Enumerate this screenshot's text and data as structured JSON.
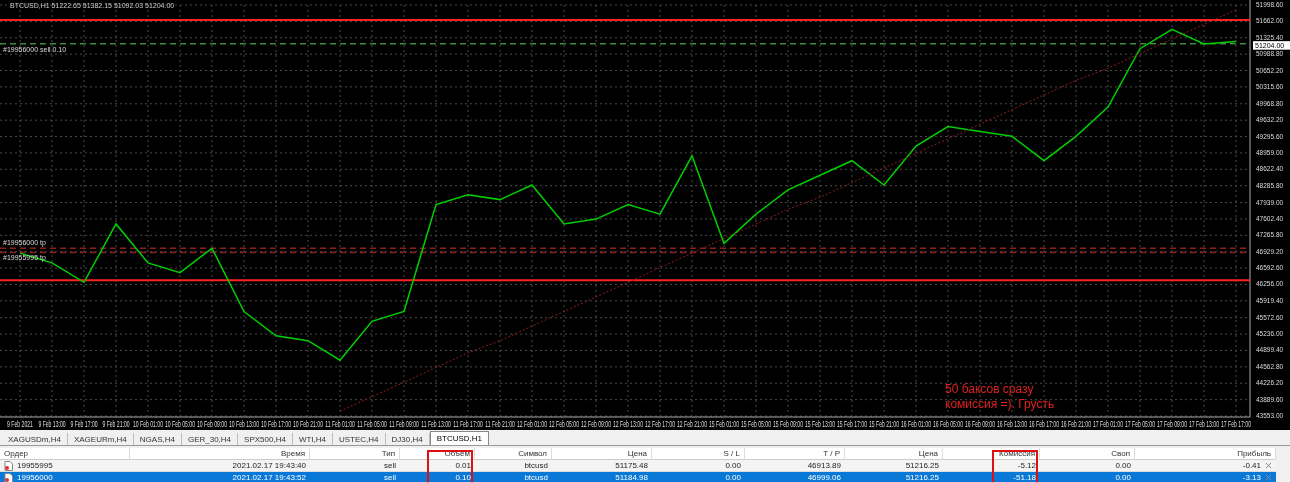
{
  "chart": {
    "current_price": "51204.00",
    "note": [
      "50 баксов сразу",
      "комиссия =). Грусть"
    ],
    "chart_data": {
      "type": "line",
      "title": "BTCUSD,H1  51222.65 51382.15 51092.03 51204.00",
      "grid": true,
      "categories": [
        "9 Feb 2021",
        "9 Feb 13:00",
        "9 Feb 17:00",
        "9 Feb 21:00",
        "10 Feb 01:00",
        "10 Feb 05:00",
        "10 Feb 09:00",
        "10 Feb 13:00",
        "10 Feb 17:00",
        "10 Feb 21:00",
        "11 Feb 01:00",
        "11 Feb 05:00",
        "11 Feb 09:00",
        "11 Feb 13:00",
        "11 Feb 17:00",
        "11 Feb 21:00",
        "12 Feb 01:00",
        "12 Feb 05:00",
        "12 Feb 09:00",
        "12 Feb 13:00",
        "12 Feb 17:00",
        "12 Feb 21:00",
        "15 Feb 01:00",
        "15 Feb 05:00",
        "15 Feb 09:00",
        "15 Feb 13:00",
        "15 Feb 17:00",
        "15 Feb 21:00",
        "16 Feb 01:00",
        "16 Feb 05:00",
        "16 Feb 09:00",
        "16 Feb 13:00",
        "16 Feb 17:00",
        "16 Feb 21:00",
        "17 Feb 01:00",
        "17 Feb 05:00",
        "17 Feb 09:00",
        "17 Feb 13:00",
        "17 Feb 17:00"
      ],
      "series": [
        {
          "color": "#00d000",
          "values": [
            46900,
            46700,
            46300,
            47500,
            46700,
            46500,
            47000,
            45700,
            45200,
            45100,
            44700,
            45500,
            45700,
            47900,
            48100,
            48000,
            48300,
            47500,
            47600,
            47900,
            47700,
            48900,
            47100,
            47700,
            48200,
            48500,
            48800,
            48300,
            49100,
            49500,
            49400,
            49300,
            48800,
            49300,
            49900,
            51100,
            51500,
            51200,
            51250
          ]
        },
        {
          "color": "#8b2020",
          "line_style": "dashed",
          "values": [
            null,
            null,
            null,
            null,
            null,
            null,
            null,
            null,
            null,
            null,
            43650,
            43950,
            44250,
            44550,
            44850,
            45100,
            45400,
            45700,
            46000,
            46300,
            46600,
            46900,
            47200,
            47500,
            47800,
            48050,
            48350,
            48650,
            48950,
            49250,
            49550,
            49850,
            50150,
            50450,
            50700,
            51000,
            51300,
            51600,
            51900
          ]
        }
      ],
      "ylim": [
        43553,
        51998.6
      ],
      "yticks": [
        {
          "value": 51998.6,
          "label": "51998.60"
        },
        {
          "value": 51662,
          "label": "51662.00"
        },
        {
          "value": 51325.4,
          "label": "51325.40"
        },
        {
          "value": 50988.8,
          "label": "50988.80"
        },
        {
          "value": 50652.2,
          "label": "50652.20"
        },
        {
          "value": 50315.6,
          "label": "50315.60"
        },
        {
          "value": 49968.8,
          "label": "49968.80"
        },
        {
          "value": 49632.2,
          "label": "49632.20"
        },
        {
          "value": 49295.6,
          "label": "49295.60"
        },
        {
          "value": 48959,
          "label": "48959.00"
        },
        {
          "value": 48622.4,
          "label": "48622.40"
        },
        {
          "value": 48285.8,
          "label": "48285.80"
        },
        {
          "value": 47939,
          "label": "47939.00"
        },
        {
          "value": 47602.4,
          "label": "47602.40"
        },
        {
          "value": 47265.8,
          "label": "47265.80"
        },
        {
          "value": 46929.2,
          "label": "46929.20"
        },
        {
          "value": 46592.6,
          "label": "46592.60"
        },
        {
          "value": 46256,
          "label": "46256.00"
        },
        {
          "value": 45919.4,
          "label": "45919.40"
        },
        {
          "value": 45572.6,
          "label": "45572.60"
        },
        {
          "value": 45236,
          "label": "45236.00"
        },
        {
          "value": 44899.4,
          "label": "44899.40"
        },
        {
          "value": 44562.8,
          "label": "44562.80"
        },
        {
          "value": 44226.2,
          "label": "44226.20"
        },
        {
          "value": 43889.6,
          "label": "43889.60"
        },
        {
          "value": 43553,
          "label": "43553.00"
        }
      ],
      "ref_lines": [
        {
          "axis": "y",
          "value": 51692,
          "color": "#ff2020"
        },
        {
          "axis": "y",
          "value": 51204,
          "color": "#3c8c3c",
          "label": "#19956000 sell 0.10"
        },
        {
          "axis": "y",
          "value": 46999.06,
          "color": "#8b2020",
          "label": "#19956000 tp"
        },
        {
          "axis": "y",
          "value": 46913.89,
          "color": "#8b2020",
          "label": "#19955995 tp"
        },
        {
          "axis": "y",
          "value": 46340,
          "color": "#ff2020"
        }
      ]
    }
  },
  "chart_tabs": [
    {
      "label": "XAGUSDm,H4",
      "selected": false
    },
    {
      "label": "XAGEURm,H4",
      "selected": false
    },
    {
      "label": "NGAS,H4",
      "selected": false
    },
    {
      "label": "GER_30,H4",
      "selected": false
    },
    {
      "label": "SPX500,H4",
      "selected": false
    },
    {
      "label": "WTI,H4",
      "selected": false
    },
    {
      "label": "USTEC,H4",
      "selected": false
    },
    {
      "label": "DJ30,H4",
      "selected": false
    },
    {
      "label": "BTCUSD,H1",
      "selected": true
    }
  ],
  "orders": {
    "columns": [
      {
        "label": "Ордер",
        "highlighted": false
      },
      {
        "label": "Время",
        "highlighted": false
      },
      {
        "label": "Тип",
        "highlighted": false
      },
      {
        "label": "Объем",
        "highlighted": true
      },
      {
        "label": "Символ",
        "highlighted": false
      },
      {
        "label": "Цена",
        "highlighted": false
      },
      {
        "label": "S / L",
        "highlighted": false
      },
      {
        "label": "T / P",
        "highlighted": false
      },
      {
        "label": "Цена",
        "highlighted": false
      },
      {
        "label": "Комиссия",
        "highlighted": true
      },
      {
        "label": "Своп",
        "highlighted": false
      },
      {
        "label": "Прибыль",
        "highlighted": false
      }
    ],
    "rows": [
      {
        "selected": false,
        "cells": [
          "19955995",
          "2021.02.17 19:43:40",
          "sell",
          "0.01",
          "btcusd",
          "51175.48",
          "0.00",
          "46913.89",
          "51216.25",
          "-5.12",
          "0.00",
          "-0.41"
        ]
      },
      {
        "selected": true,
        "cells": [
          "19956000",
          "2021.02.17 19:43:52",
          "sell",
          "0.10",
          "btcusd",
          "51184.98",
          "0.00",
          "46999.06",
          "51216.25",
          "-51.18",
          "0.00",
          "-3.13"
        ]
      }
    ]
  }
}
